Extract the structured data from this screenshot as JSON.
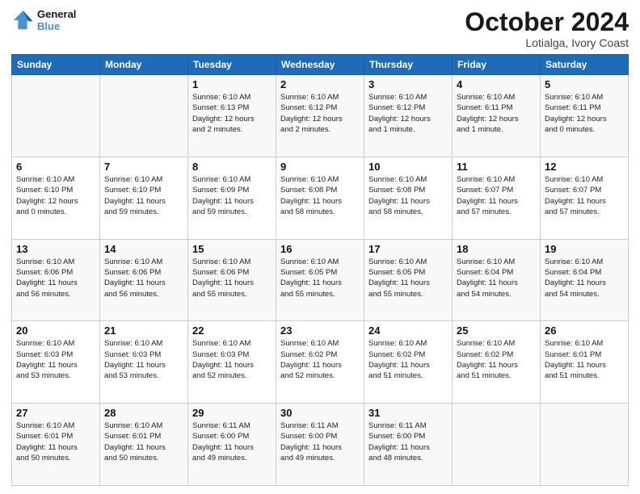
{
  "logo": {
    "line1": "General",
    "line2": "Blue"
  },
  "title": "October 2024",
  "subtitle": "Lotialga, Ivory Coast",
  "days_of_week": [
    "Sunday",
    "Monday",
    "Tuesday",
    "Wednesday",
    "Thursday",
    "Friday",
    "Saturday"
  ],
  "weeks": [
    [
      {
        "day": "",
        "info": ""
      },
      {
        "day": "",
        "info": ""
      },
      {
        "day": "1",
        "info": "Sunrise: 6:10 AM\nSunset: 6:13 PM\nDaylight: 12 hours\nand 2 minutes."
      },
      {
        "day": "2",
        "info": "Sunrise: 6:10 AM\nSunset: 6:12 PM\nDaylight: 12 hours\nand 2 minutes."
      },
      {
        "day": "3",
        "info": "Sunrise: 6:10 AM\nSunset: 6:12 PM\nDaylight: 12 hours\nand 1 minute."
      },
      {
        "day": "4",
        "info": "Sunrise: 6:10 AM\nSunset: 6:11 PM\nDaylight: 12 hours\nand 1 minute."
      },
      {
        "day": "5",
        "info": "Sunrise: 6:10 AM\nSunset: 6:11 PM\nDaylight: 12 hours\nand 0 minutes."
      }
    ],
    [
      {
        "day": "6",
        "info": "Sunrise: 6:10 AM\nSunset: 6:10 PM\nDaylight: 12 hours\nand 0 minutes."
      },
      {
        "day": "7",
        "info": "Sunrise: 6:10 AM\nSunset: 6:10 PM\nDaylight: 11 hours\nand 59 minutes."
      },
      {
        "day": "8",
        "info": "Sunrise: 6:10 AM\nSunset: 6:09 PM\nDaylight: 11 hours\nand 59 minutes."
      },
      {
        "day": "9",
        "info": "Sunrise: 6:10 AM\nSunset: 6:08 PM\nDaylight: 11 hours\nand 58 minutes."
      },
      {
        "day": "10",
        "info": "Sunrise: 6:10 AM\nSunset: 6:08 PM\nDaylight: 11 hours\nand 58 minutes."
      },
      {
        "day": "11",
        "info": "Sunrise: 6:10 AM\nSunset: 6:07 PM\nDaylight: 11 hours\nand 57 minutes."
      },
      {
        "day": "12",
        "info": "Sunrise: 6:10 AM\nSunset: 6:07 PM\nDaylight: 11 hours\nand 57 minutes."
      }
    ],
    [
      {
        "day": "13",
        "info": "Sunrise: 6:10 AM\nSunset: 6:06 PM\nDaylight: 11 hours\nand 56 minutes."
      },
      {
        "day": "14",
        "info": "Sunrise: 6:10 AM\nSunset: 6:06 PM\nDaylight: 11 hours\nand 56 minutes."
      },
      {
        "day": "15",
        "info": "Sunrise: 6:10 AM\nSunset: 6:06 PM\nDaylight: 11 hours\nand 55 minutes."
      },
      {
        "day": "16",
        "info": "Sunrise: 6:10 AM\nSunset: 6:05 PM\nDaylight: 11 hours\nand 55 minutes."
      },
      {
        "day": "17",
        "info": "Sunrise: 6:10 AM\nSunset: 6:05 PM\nDaylight: 11 hours\nand 55 minutes."
      },
      {
        "day": "18",
        "info": "Sunrise: 6:10 AM\nSunset: 6:04 PM\nDaylight: 11 hours\nand 54 minutes."
      },
      {
        "day": "19",
        "info": "Sunrise: 6:10 AM\nSunset: 6:04 PM\nDaylight: 11 hours\nand 54 minutes."
      }
    ],
    [
      {
        "day": "20",
        "info": "Sunrise: 6:10 AM\nSunset: 6:03 PM\nDaylight: 11 hours\nand 53 minutes."
      },
      {
        "day": "21",
        "info": "Sunrise: 6:10 AM\nSunset: 6:03 PM\nDaylight: 11 hours\nand 53 minutes."
      },
      {
        "day": "22",
        "info": "Sunrise: 6:10 AM\nSunset: 6:03 PM\nDaylight: 11 hours\nand 52 minutes."
      },
      {
        "day": "23",
        "info": "Sunrise: 6:10 AM\nSunset: 6:02 PM\nDaylight: 11 hours\nand 52 minutes."
      },
      {
        "day": "24",
        "info": "Sunrise: 6:10 AM\nSunset: 6:02 PM\nDaylight: 11 hours\nand 51 minutes."
      },
      {
        "day": "25",
        "info": "Sunrise: 6:10 AM\nSunset: 6:02 PM\nDaylight: 11 hours\nand 51 minutes."
      },
      {
        "day": "26",
        "info": "Sunrise: 6:10 AM\nSunset: 6:01 PM\nDaylight: 11 hours\nand 51 minutes."
      }
    ],
    [
      {
        "day": "27",
        "info": "Sunrise: 6:10 AM\nSunset: 6:01 PM\nDaylight: 11 hours\nand 50 minutes."
      },
      {
        "day": "28",
        "info": "Sunrise: 6:10 AM\nSunset: 6:01 PM\nDaylight: 11 hours\nand 50 minutes."
      },
      {
        "day": "29",
        "info": "Sunrise: 6:11 AM\nSunset: 6:00 PM\nDaylight: 11 hours\nand 49 minutes."
      },
      {
        "day": "30",
        "info": "Sunrise: 6:11 AM\nSunset: 6:00 PM\nDaylight: 11 hours\nand 49 minutes."
      },
      {
        "day": "31",
        "info": "Sunrise: 6:11 AM\nSunset: 6:00 PM\nDaylight: 11 hours\nand 48 minutes."
      },
      {
        "day": "",
        "info": ""
      },
      {
        "day": "",
        "info": ""
      }
    ]
  ]
}
